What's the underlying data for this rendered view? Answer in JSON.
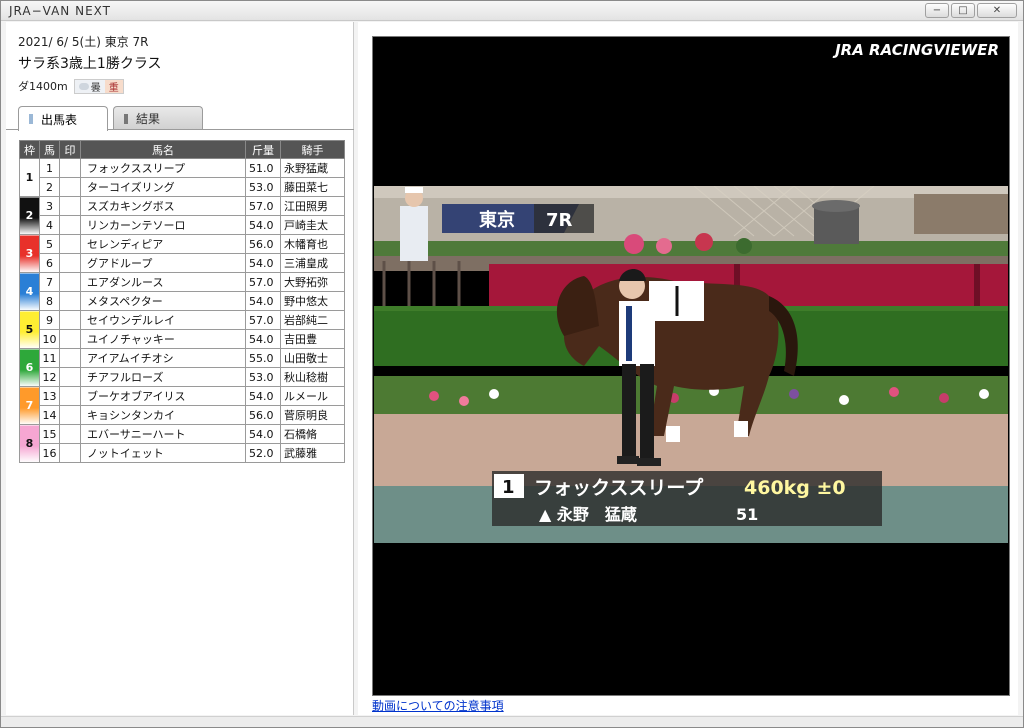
{
  "app": {
    "title": "JRA−VAN NEXT"
  },
  "window_buttons": {
    "minimize": "−",
    "maximize": "□",
    "close": "✕"
  },
  "race": {
    "date_venue": "2021/ 6/ 5(土) 東京 7R",
    "name": "サラ系3歳上1勝クラス",
    "distance": "ダ1400m",
    "weather": "曇",
    "track": "重"
  },
  "tabs": [
    {
      "label": "出馬表",
      "active": true
    },
    {
      "label": "結果",
      "active": false
    }
  ],
  "table": {
    "headers": [
      "枠",
      "馬",
      "印",
      "馬名",
      "斤量",
      "騎手"
    ],
    "waku_colors": {
      "1": "#ffffff",
      "2": "#111111",
      "3": "#e8312a",
      "4": "#2a7fd6",
      "5": "#ffee33",
      "6": "#2ea83a",
      "7": "#ff9a2a",
      "8": "#f6a6d2"
    },
    "rows": [
      {
        "waku": "1",
        "uma": "1",
        "mark": "",
        "name": "フォックススリープ",
        "weight": "51.0",
        "jockey": "永野猛蔵"
      },
      {
        "waku": "1",
        "uma": "2",
        "mark": "",
        "name": "ターコイズリング",
        "weight": "53.0",
        "jockey": "藤田菜七"
      },
      {
        "waku": "2",
        "uma": "3",
        "mark": "",
        "name": "スズカキングボス",
        "weight": "57.0",
        "jockey": "江田照男"
      },
      {
        "waku": "2",
        "uma": "4",
        "mark": "",
        "name": "リンカーンテソーロ",
        "weight": "54.0",
        "jockey": "戸崎圭太"
      },
      {
        "waku": "3",
        "uma": "5",
        "mark": "",
        "name": "セレンディピア",
        "weight": "56.0",
        "jockey": "木幡育也"
      },
      {
        "waku": "3",
        "uma": "6",
        "mark": "",
        "name": "グアドループ",
        "weight": "54.0",
        "jockey": "三浦皇成"
      },
      {
        "waku": "4",
        "uma": "7",
        "mark": "",
        "name": "エアダンルース",
        "weight": "57.0",
        "jockey": "大野拓弥"
      },
      {
        "waku": "4",
        "uma": "8",
        "mark": "",
        "name": "メタスペクター",
        "weight": "54.0",
        "jockey": "野中悠太"
      },
      {
        "waku": "5",
        "uma": "9",
        "mark": "",
        "name": "セイウンデルレイ",
        "weight": "57.0",
        "jockey": "岩部純二"
      },
      {
        "waku": "5",
        "uma": "10",
        "mark": "",
        "name": "ユイノチャッキー",
        "weight": "54.0",
        "jockey": "吉田豊"
      },
      {
        "waku": "6",
        "uma": "11",
        "mark": "",
        "name": "アイアムイチオシ",
        "weight": "55.0",
        "jockey": "山田敬士"
      },
      {
        "waku": "6",
        "uma": "12",
        "mark": "",
        "name": "チアフルローズ",
        "weight": "53.0",
        "jockey": "秋山稔樹"
      },
      {
        "waku": "7",
        "uma": "13",
        "mark": "",
        "name": "ブーケオブアイリス",
        "weight": "54.0",
        "jockey": "ルメール"
      },
      {
        "waku": "7",
        "uma": "14",
        "mark": "",
        "name": "キョシンタンカイ",
        "weight": "56.0",
        "jockey": "菅原明良"
      },
      {
        "waku": "8",
        "uma": "15",
        "mark": "",
        "name": "エバーサニーハート",
        "weight": "54.0",
        "jockey": "石橋脩"
      },
      {
        "waku": "8",
        "uma": "16",
        "mark": "",
        "name": "ノットイェット",
        "weight": "52.0",
        "jockey": "武藤雅"
      }
    ]
  },
  "video": {
    "logo": "JRA RACINGVIEWER",
    "overlay_venue": "東京",
    "overlay_race": "7R",
    "caption_number": "1",
    "caption_name": "フォックススリープ",
    "caption_weight": "460kg ±0",
    "caption_jockey": "▲ 永野　猛蔵",
    "caption_kinryo": "51",
    "saddle_cloth_number": "1",
    "saddle_cloth_name": "フォックススリープ"
  },
  "notice_link": "動画についての注意事項"
}
